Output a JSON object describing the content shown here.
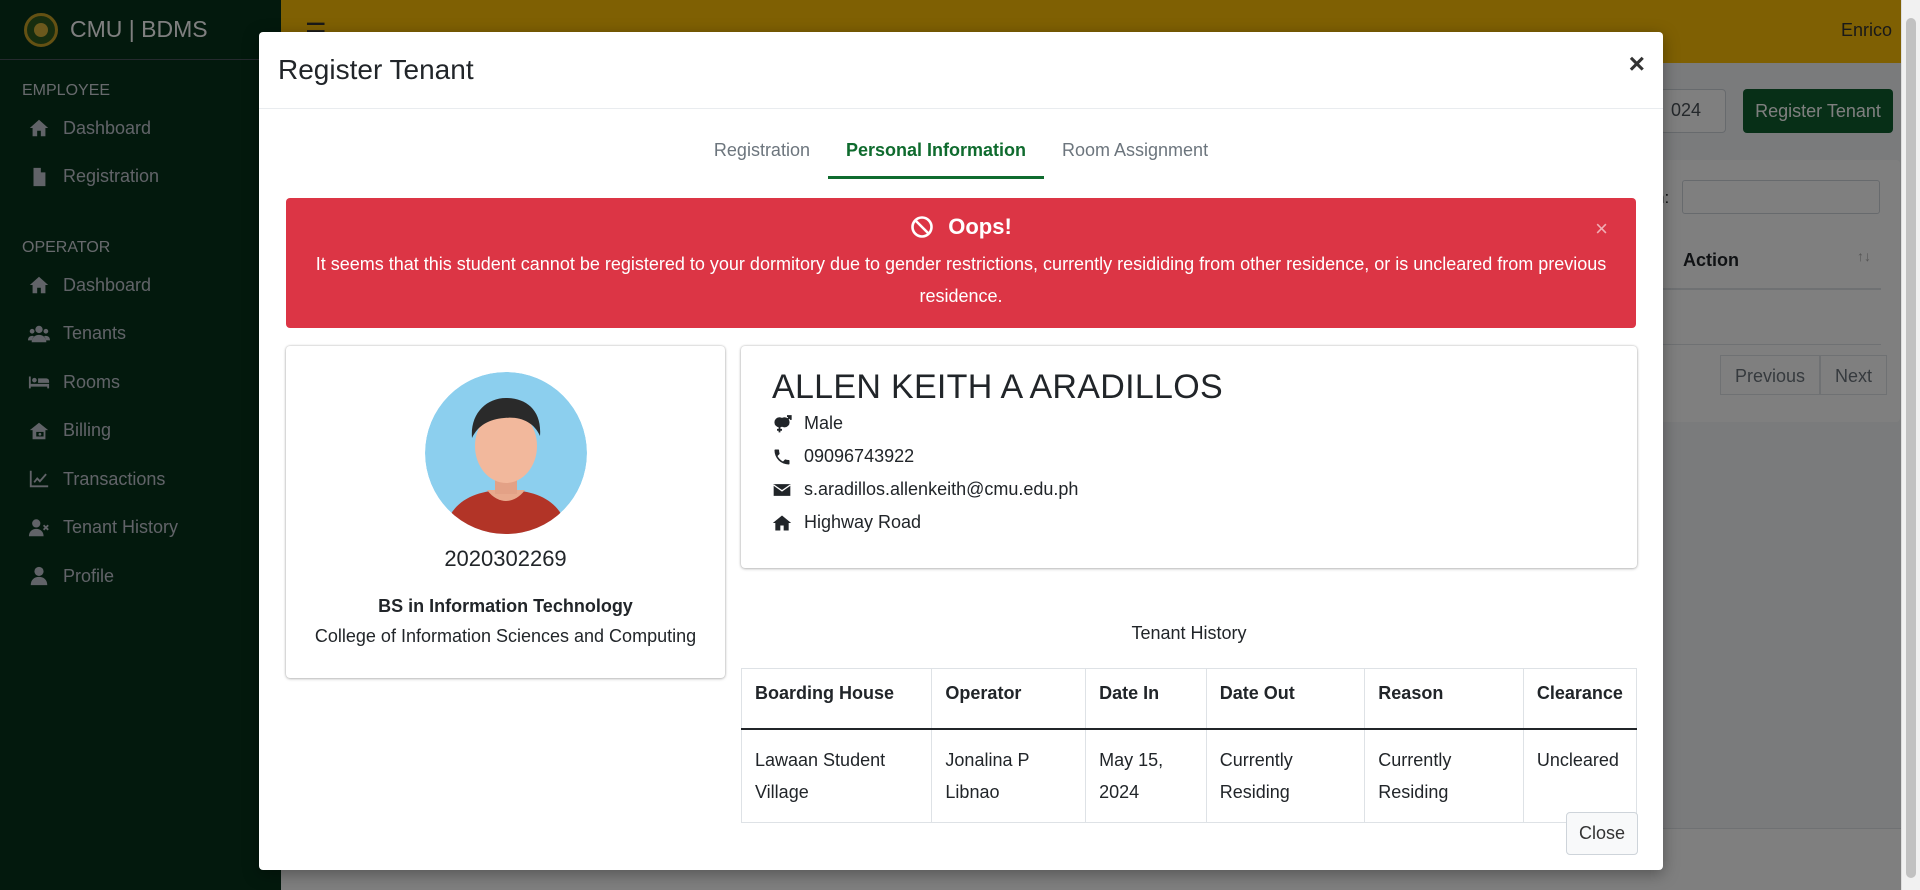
{
  "brand": {
    "title": "CMU | BDMS"
  },
  "sidebar": {
    "employee_header": "EMPLOYEE",
    "employee_items": [
      {
        "label": "Dashboard",
        "icon": "home-icon"
      },
      {
        "label": "Registration",
        "icon": "file-icon"
      }
    ],
    "operator_header": "OPERATOR",
    "operator_items": [
      {
        "label": "Dashboard",
        "icon": "home-icon"
      },
      {
        "label": "Tenants",
        "icon": "users-icon"
      },
      {
        "label": "Rooms",
        "icon": "bed-icon"
      },
      {
        "label": "Billing",
        "icon": "billing-icon"
      },
      {
        "label": "Transactions",
        "icon": "chart-line-icon"
      },
      {
        "label": "Tenant History",
        "icon": "user-times-icon"
      },
      {
        "label": "Profile",
        "icon": "user-icon"
      }
    ]
  },
  "topbar": {
    "hamburger": "☰",
    "user": "Enrico"
  },
  "background": {
    "select_value": "024",
    "register_button": "Register Tenant",
    "search_label": "n:",
    "action_header": "Action",
    "sort_icon": "↑↓",
    "pager": {
      "previous": "Previous",
      "next": "Next"
    }
  },
  "modal": {
    "title": "Register Tenant",
    "close_x": "×",
    "tabs": [
      {
        "label": "Registration",
        "active": false
      },
      {
        "label": "Personal Information",
        "active": true
      },
      {
        "label": "Room Assignment",
        "active": false
      }
    ],
    "alert": {
      "title": "Oops!",
      "message": "It seems that this student cannot be registered to your dormitory due to gender restrictions, currently resididing from other residence, or is uncleared from previous residence.",
      "close": "×",
      "color": "#dc3545"
    },
    "profile": {
      "student_id": "2020302269",
      "program": "BS in Information Technology",
      "college": "College of Information Sciences and Computing"
    },
    "info": {
      "name": "ALLEN KEITH A ARADILLOS",
      "gender": "Male",
      "phone": "09096743922",
      "email": "s.aradillos.allenkeith@cmu.edu.ph",
      "address": "Highway Road"
    },
    "history": {
      "caption": "Tenant History",
      "columns": [
        "Boarding House",
        "Operator",
        "Date In",
        "Date Out",
        "Reason",
        "Clearance"
      ],
      "rows": [
        [
          "Lawaan Student Village",
          "Jonalina P Libnao",
          "May 15, 2024",
          "Currently Residing",
          "Currently Residing",
          "Uncleared"
        ]
      ]
    },
    "footer_close": "Close"
  },
  "colors": {
    "sidebar": "#07331b",
    "topbar": "#ffc107",
    "accent": "#0f6b2e",
    "danger": "#dc3545"
  }
}
